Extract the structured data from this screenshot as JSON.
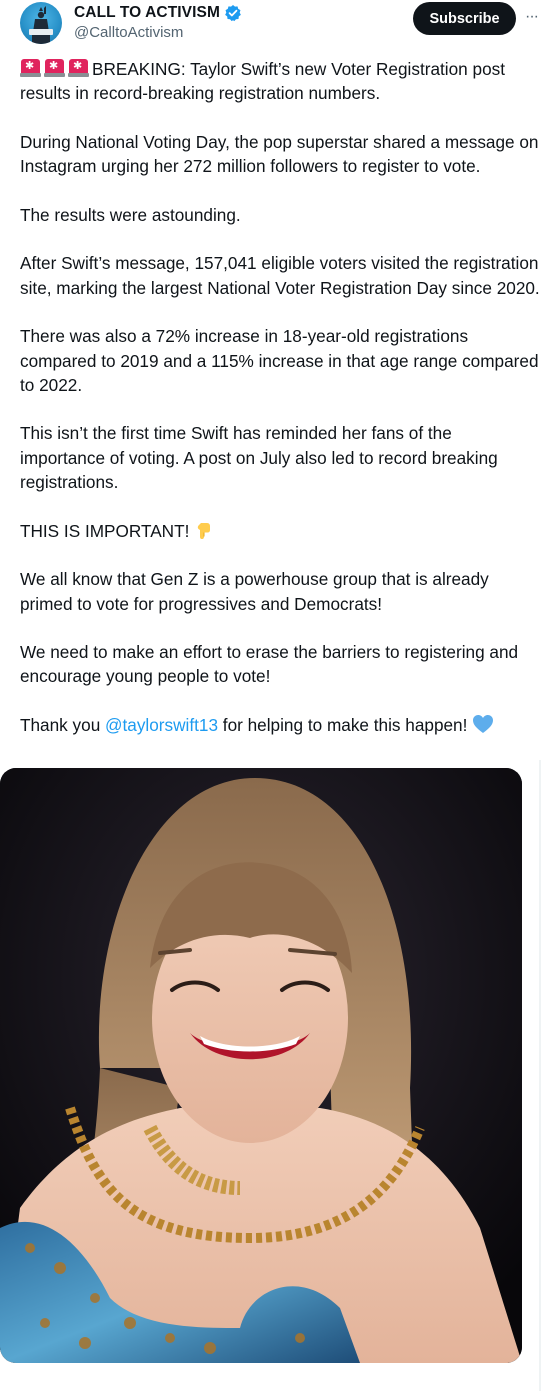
{
  "author": {
    "display_name": "CALL TO ACTIVISM",
    "handle": "@CalltoActivism",
    "avatar_icon": "statue-of-liberty-avatar",
    "verified_icon": "verified-badge-icon",
    "verified_color": "#1d9bf0"
  },
  "actions": {
    "subscribe_label": "Subscribe",
    "more_icon": "more-options-icon"
  },
  "post": {
    "p1_text": "BREAKING: Taylor Swift’s new Voter Registration post results in record-breaking registration numbers.",
    "p1_icons": [
      "police-light-icon",
      "police-light-icon",
      "police-light-icon"
    ],
    "p2": "During National Voting Day, the pop superstar shared a message on Instagram urging her 272 million followers to register to vote.",
    "p3": "The results were astounding.",
    "p4": "After Swift’s message, 157,041 eligible voters visited the registration site, marking the largest National Voter Registration Day since 2020.",
    "p5": "There was also a 72% increase in 18-year-old registrations compared to 2019 and a 115% increase in that age range compared to 2022.",
    "p6": "This isn’t the first time Swift has reminded her fans of the importance of voting. A post on July also led to record breaking registrations.",
    "p7": "THIS IS IMPORTANT!",
    "p7_icon": "pointing-down-icon",
    "p8": "We all know that Gen Z is a powerhouse group that is already primed to vote for progressives and Democrats!",
    "p9": "We need to make an effort to erase the barriers to registering and encourage young people to vote!",
    "p10_before": "Thank you ",
    "p10_mention": "@taylorswift13",
    "p10_after": " for helping to make this happen!",
    "p10_icon": "blue-heart-icon",
    "mention_color": "#1d9bf0"
  },
  "media": {
    "image_icon": "performer-photo"
  }
}
